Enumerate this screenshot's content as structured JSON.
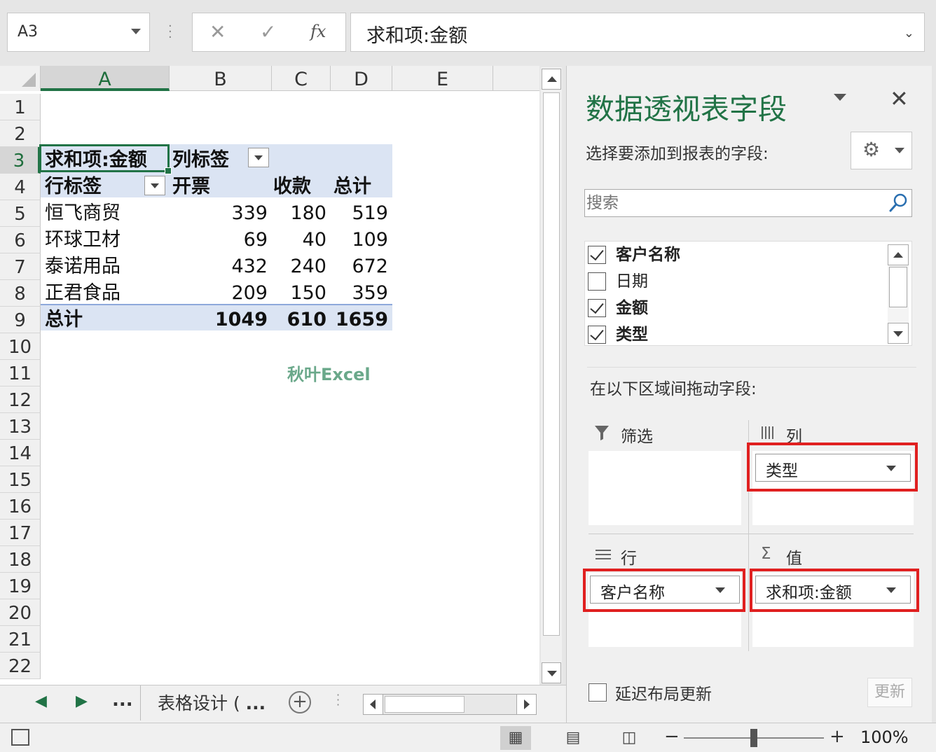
{
  "formula_bar": {
    "name_box": "A3",
    "cancel_glyph": "✕",
    "enter_glyph": "✓",
    "fx_glyph": "fx",
    "formula": "求和项:金额"
  },
  "grid": {
    "columns": [
      "A",
      "B",
      "C",
      "D",
      "E"
    ],
    "rows": [
      "1",
      "2",
      "3",
      "4",
      "5",
      "6",
      "7",
      "8",
      "9",
      "10",
      "11",
      "12",
      "13",
      "14",
      "15",
      "16",
      "17",
      "18",
      "19",
      "20",
      "21",
      "22"
    ],
    "pivot": {
      "header_value": "求和项:金额",
      "col_label": "列标签",
      "row_label": "行标签",
      "col_heads": [
        "开票",
        "收款",
        "总计"
      ],
      "data_rows": [
        {
          "name": "恒飞商贸",
          "v1": "339",
          "v2": "180",
          "total": "519"
        },
        {
          "name": "环球卫材",
          "v1": "69",
          "v2": "40",
          "total": "109"
        },
        {
          "name": "泰诺用品",
          "v1": "432",
          "v2": "240",
          "total": "672"
        },
        {
          "name": "正君食品",
          "v1": "209",
          "v2": "150",
          "total": "359"
        }
      ],
      "total_row": {
        "name": "总计",
        "v1": "1049",
        "v2": "610",
        "total": "1659"
      }
    },
    "watermark": "秋叶Excel"
  },
  "tabbar": {
    "more": "...",
    "sheet_tab": "表格设计 (",
    "more2": "...",
    "add": "+"
  },
  "statusbar": {
    "zoom_minus": "−",
    "zoom_plus": "+",
    "zoom": "100%"
  },
  "pane": {
    "title": "数据透视表字段",
    "close": "✕",
    "subtitle": "选择要添加到报表的字段:",
    "search_placeholder": "搜索",
    "fields": [
      {
        "label": "客户名称",
        "checked": true
      },
      {
        "label": "日期",
        "checked": false
      },
      {
        "label": "金额",
        "checked": true
      },
      {
        "label": "类型",
        "checked": true
      }
    ],
    "drag_label": "在以下区域间拖动字段:",
    "areas": {
      "filter": {
        "label": "筛选",
        "icon": "filter-icon"
      },
      "columns": {
        "label": "列",
        "icon": "columns-icon",
        "chip": "类型"
      },
      "rows": {
        "label": "行",
        "icon": "rows-icon",
        "chip": "客户名称"
      },
      "values": {
        "label": "值",
        "icon": "sigma-icon",
        "chip": "求和项:金额"
      }
    },
    "defer_label": "延迟布局更新",
    "update_label": "更新"
  },
  "colors": {
    "excel_green": "#217346",
    "pivot_header_bg": "#dbe4f3",
    "highlight_red": "#e02020"
  }
}
